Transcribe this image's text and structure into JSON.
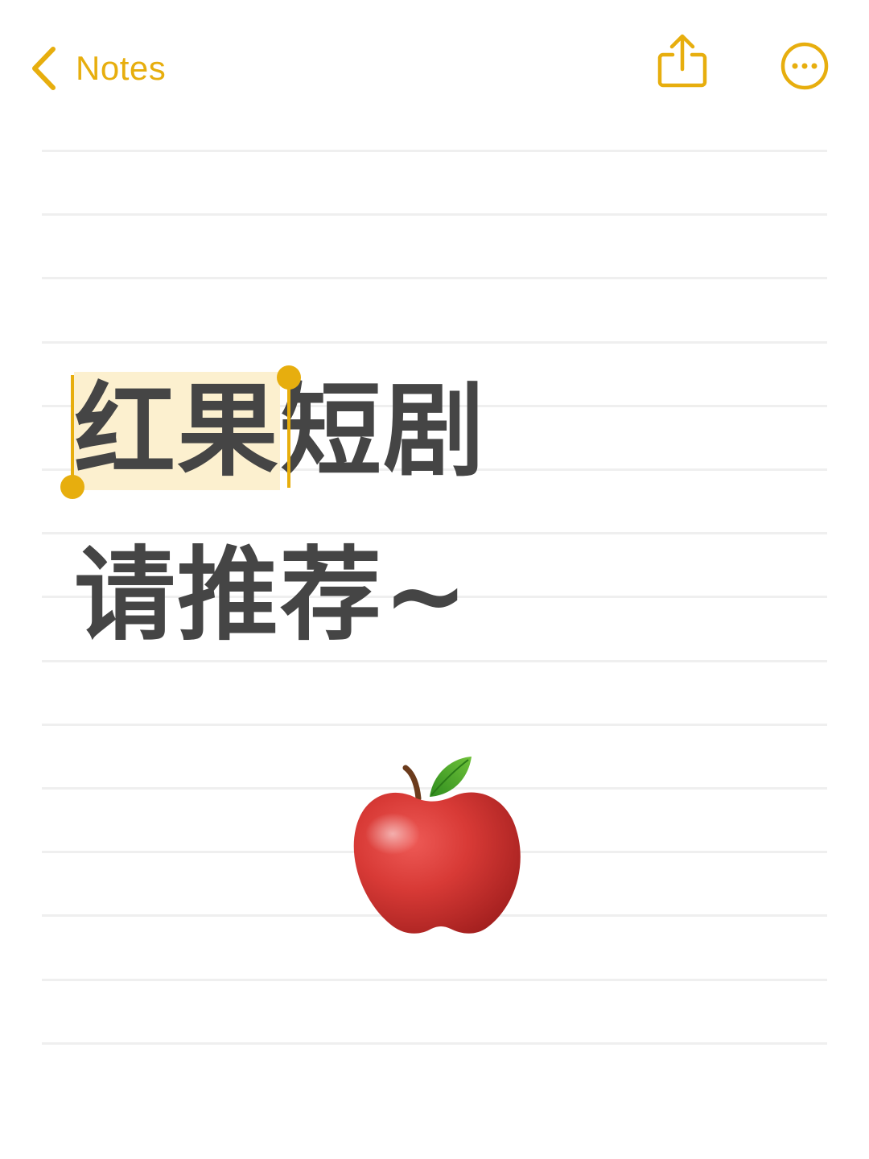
{
  "nav": {
    "back_label": "Notes",
    "back_icon": "chevron-left-icon",
    "share_icon": "share-icon",
    "more_icon": "ellipsis-circle-icon",
    "accent_color": "#e7ae0e"
  },
  "note": {
    "line1_selected": "红果",
    "line1_rest": "短剧",
    "line2": "请推荐~",
    "emoji": "apple-emoji",
    "text_color": "#454545",
    "selection_color": "#fcf0cf"
  }
}
